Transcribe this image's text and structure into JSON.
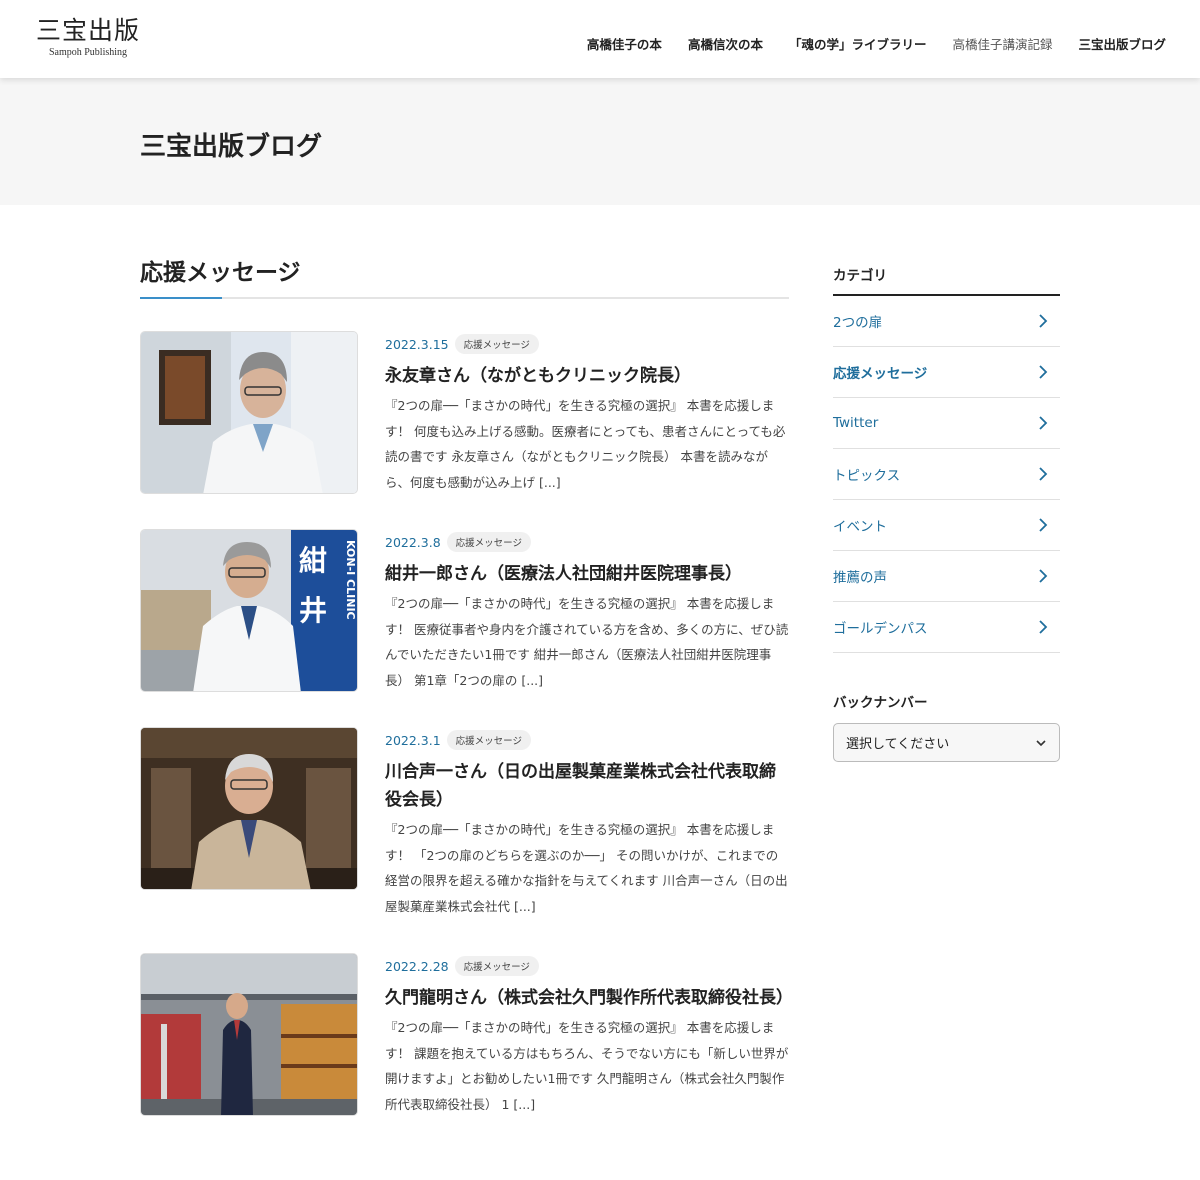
{
  "header": {
    "logo_main": "三宝出版",
    "logo_sub": "Sampoh Publishing",
    "nav": [
      {
        "label": "高橋佳子の本"
      },
      {
        "label": "高橋信次の本"
      },
      {
        "label": "「魂の学」ライブラリー"
      },
      {
        "label": "高橋佳子講演記録"
      },
      {
        "label": "三宝出版ブログ"
      }
    ]
  },
  "page_title": "三宝出版ブログ",
  "section_title": "応援メッセージ",
  "posts": [
    {
      "date": "2022.3.15",
      "category": "応援メッセージ",
      "title": "永友章さん（ながともクリニック院長）",
      "excerpt": "『2つの扉──「まさかの時代」を生きる究極の選択』 本書を応援します！ 何度も込み上げる感動。医療者にとっても、患者さんにとっても必読の書です 永友章さん（ながともクリニック院長） 本書を読みながら、何度も感動が込み上げ [...]"
    },
    {
      "date": "2022.3.8",
      "category": "応援メッセージ",
      "title": "紺井一郎さん（医療法人社団紺井医院理事長）",
      "excerpt": "『2つの扉──「まさかの時代」を生きる究極の選択』 本書を応援します！ 医療従事者や身内を介護されている方を含め、多くの方に、ぜひ読んでいただきたい1冊です 紺井一郎さん（医療法人社団紺井医院理事長） 第1章「2つの扉の [...]",
      "image_text": "KON-I CLINIC"
    },
    {
      "date": "2022.3.1",
      "category": "応援メッセージ",
      "title": "川合声一さん（日の出屋製菓産業株式会社代表取締役会長）",
      "excerpt": "『2つの扉──「まさかの時代」を生きる究極の選択』 本書を応援します！ 「2つの扉のどちらを選ぶのか──」 その問いかけが、これまでの経営の限界を超える確かな指針を与えてくれます 川合声一さん（日の出屋製菓産業株式会社代 [...]"
    },
    {
      "date": "2022.2.28",
      "category": "応援メッセージ",
      "title": "久門龍明さん（株式会社久門製作所代表取締役社長）",
      "excerpt": "『2つの扉──「まさかの時代」を生きる究極の選択』 本書を応援します！ 課題を抱えている方はもちろん、そうでない方にも「新しい世界が開けますよ」とお勧めしたい1冊です 久門龍明さん（株式会社久門製作所代表取締役社長） 1 [...]"
    }
  ],
  "sidebar": {
    "category_heading": "カテゴリ",
    "categories": [
      {
        "label": "2つの扉"
      },
      {
        "label": "応援メッセージ"
      },
      {
        "label": "Twitter"
      },
      {
        "label": "トピックス"
      },
      {
        "label": "イベント"
      },
      {
        "label": "推薦の声"
      },
      {
        "label": "ゴールデンパス"
      }
    ],
    "back_number_heading": "バックナンバー",
    "select_label": "選択してください"
  },
  "colors": {
    "accent_blue": "#1f6e9c",
    "rule_accent": "#3a8fc9",
    "band_bg": "#f6f6f6"
  }
}
